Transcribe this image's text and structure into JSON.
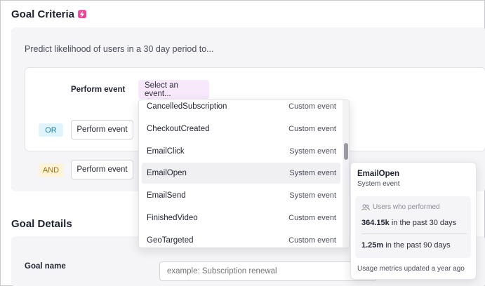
{
  "criteria": {
    "title": "Goal Criteria",
    "badge_icon": "bolt-icon",
    "prompt": "Predict likelihood of users in a 30 day period to...",
    "perform_event_label": "Perform event",
    "select_placeholder": "Select an event...",
    "or_label": "OR",
    "and_label": "AND",
    "or_button": "Perform event",
    "and_button": "Perform event"
  },
  "dropdown": {
    "items": [
      {
        "name": "CancelledSubscription",
        "type": "Custom event"
      },
      {
        "name": "CheckoutCreated",
        "type": "Custom event"
      },
      {
        "name": "EmailClick",
        "type": "System event"
      },
      {
        "name": "EmailOpen",
        "type": "System event"
      },
      {
        "name": "EmailSend",
        "type": "System event"
      },
      {
        "name": "FinishedVideo",
        "type": "Custom event"
      },
      {
        "name": "GeoTargeted",
        "type": "Custom event"
      }
    ],
    "hovered": "EmailOpen"
  },
  "tooltip": {
    "title": "EmailOpen",
    "subtitle": "System event",
    "users_label": "Users who performed",
    "metric1_value": "364.15k",
    "metric1_text": "in the past 30 days",
    "metric2_value": "1.25m",
    "metric2_text": "in the past 90 days",
    "footer": "Usage metrics updated a year ago"
  },
  "details": {
    "title": "Goal Details",
    "goal_name_label": "Goal name",
    "goal_name_placeholder": "example: Subscription renewal"
  }
}
